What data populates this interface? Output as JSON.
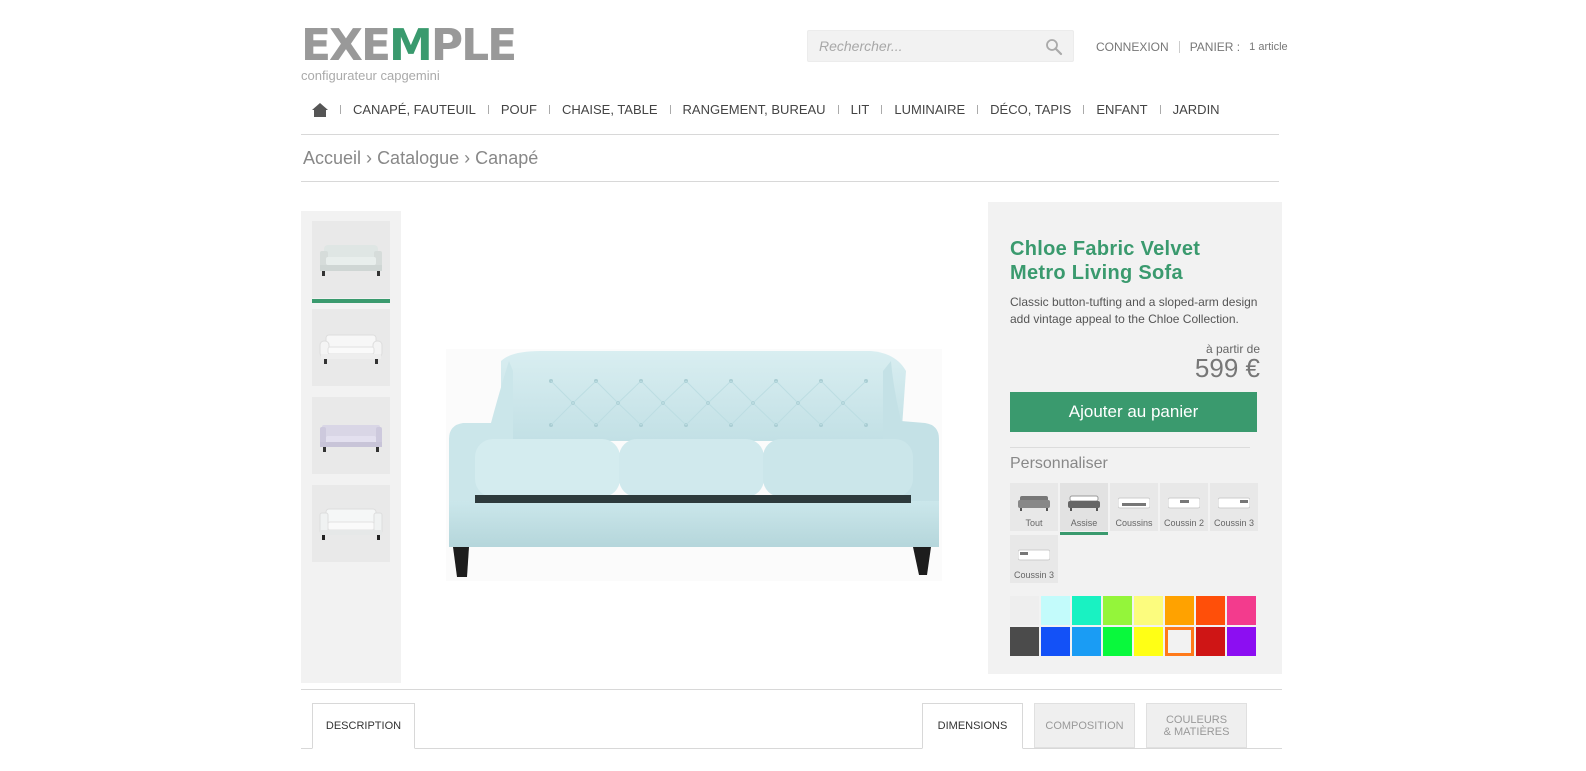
{
  "header": {
    "logo_part1": "EXE",
    "logo_accent": "M",
    "logo_part2": "PLE",
    "logo_subtitle": "configurateur capgemini",
    "search_placeholder": "Rechercher...",
    "login_label": "CONNEXION",
    "cart_label": "PANIER :",
    "cart_count": "1 article"
  },
  "nav": {
    "items": [
      "CANAPÉ, FAUTEUIL",
      "POUF",
      "CHAISE, TABLE",
      "RANGEMENT, BUREAU",
      "LIT",
      "LUMINAIRE",
      "DÉCO, TAPIS",
      "ENFANT",
      "JARDIN"
    ]
  },
  "breadcrumb": {
    "items": [
      "Accueil",
      "Catalogue",
      "Canapé"
    ],
    "separator": "›"
  },
  "product": {
    "title": "Chloe Fabric Velvet Metro Living Sofa",
    "description": "Classic button-tufting and a sloped-arm design add vintage appeal to the Chloe Collection.",
    "price_from_label": "à partir de",
    "price": "599 €",
    "add_to_cart_label": "Ajouter au panier",
    "customize_label": "Personnaliser",
    "sofa_color": "#cfe8ec",
    "accent_color": "#3a9a6e"
  },
  "parts": [
    "Tout",
    "Assise",
    "Coussins",
    "Coussin 2",
    "Coussin 3",
    "Coussin 3"
  ],
  "selected_part": "Assise",
  "swatches": {
    "row1": [
      "#eeeeee",
      "#c3fbfb",
      "#19f2c2",
      "#94f53a",
      "#fcfc7e",
      "#ffa200",
      "#ff4f09",
      "#f33b8d"
    ],
    "row2": [
      "#4b4b4b",
      "#1351f7",
      "#1a9cf4",
      "#09f93c",
      "#ffff15",
      "#f2f2f2",
      "#cf1515",
      "#8c0ef2"
    ],
    "selected": "row2-6"
  },
  "tabs": {
    "description": "DESCRIPTION",
    "dimensions": "DIMENSIONS",
    "composition": "COMPOSITION",
    "colors_line1": "COULEURS",
    "colors_line2": "& MATIÈRES"
  }
}
